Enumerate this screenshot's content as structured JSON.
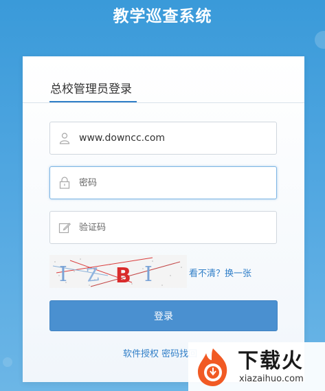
{
  "app": {
    "title": "教学巡查系统"
  },
  "login_tab": {
    "label": "总校管理员登录"
  },
  "username": {
    "value": "www.downcc.com"
  },
  "password": {
    "placeholder": "密码"
  },
  "captcha_field": {
    "placeholder": "验证码"
  },
  "captcha": {
    "text": "IZBI",
    "refresh_label": "看不清？换一张"
  },
  "login_button": {
    "label": "登录"
  },
  "footer": {
    "license_label": "软件授权",
    "recover_label": "密码找回"
  },
  "watermark": {
    "brand": "下载火",
    "domain": "xiazaihuo.com"
  },
  "colors": {
    "background": "#4aa3de",
    "accent": "#2f7ec7",
    "button": "#4a90d0",
    "watermark_orange": "#f15a24"
  }
}
